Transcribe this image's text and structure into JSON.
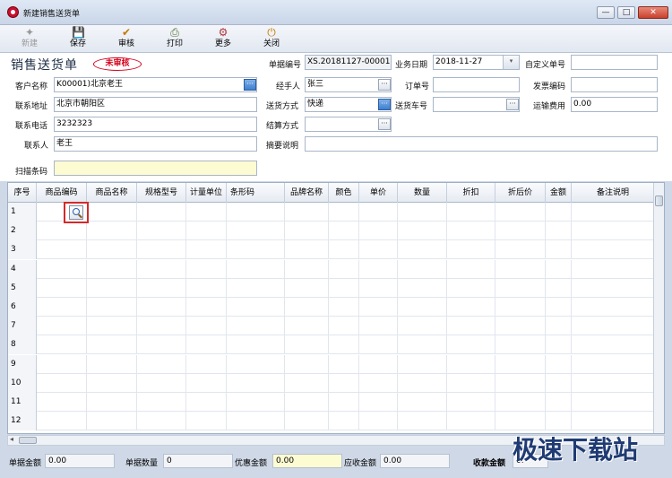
{
  "window": {
    "title": "新建销售送货单",
    "min": "—",
    "max": "□",
    "close": "✕"
  },
  "toolbar": [
    {
      "label": "新建",
      "icon": "new-icon",
      "glyph": "✦",
      "enabled": false
    },
    {
      "label": "保存",
      "icon": "save-icon",
      "glyph": "💾",
      "enabled": true
    },
    {
      "label": "审核",
      "icon": "approve-icon",
      "glyph": "✔",
      "enabled": true
    },
    {
      "label": "打印",
      "icon": "print-icon",
      "glyph": "⎙",
      "enabled": true
    },
    {
      "label": "更多",
      "icon": "more-icon",
      "glyph": "⚙",
      "enabled": true
    },
    {
      "label": "关闭",
      "icon": "close-doc-icon",
      "glyph": "⏻",
      "enabled": true
    }
  ],
  "form": {
    "doc_title": "销售送货单",
    "stamp": "未审核",
    "doc_no_label": "单据编号",
    "doc_no": "XS.20181127-00001",
    "date_label": "业务日期",
    "date": "2018-11-27",
    "custom_no_label": "自定义单号",
    "custom_no": "",
    "customer_label": "客户名称",
    "customer": "K00001)北京老王",
    "handler_label": "经手人",
    "handler": "张三",
    "order_no_label": "订单号",
    "order_no": "",
    "invoice_label": "发票编码",
    "invoice": "",
    "address_label": "联系地址",
    "address": "北京市朝阳区",
    "delivery_label": "送货方式",
    "delivery": "快递",
    "car_label": "送货车号",
    "car": "",
    "freight_label": "运输费用",
    "freight": "0.00",
    "phone_label": "联系电话",
    "phone": "3232323",
    "settle_label": "结算方式",
    "settle": "",
    "contact_label": "联系人",
    "contact": "老王",
    "memo_label": "摘要说明",
    "memo": "",
    "scan_label": "扫描条码",
    "scan": ""
  },
  "grid": {
    "columns": [
      "序号",
      "商品编码",
      "商品名称",
      "规格型号",
      "计量单位",
      "条形码",
      "品牌名称",
      "颜色",
      "单价",
      "数量",
      "折扣",
      "折后价",
      "金额",
      "备注说明"
    ],
    "rows": [
      "1",
      "2",
      "3",
      "4",
      "5",
      "6",
      "7",
      "8",
      "9",
      "10",
      "11",
      "12"
    ]
  },
  "footer": {
    "doc_amount_label": "单据金额",
    "doc_amount": "0.00",
    "doc_qty_label": "单据数量",
    "doc_qty": "0",
    "discount_label": "优惠金额",
    "discount": "0.00",
    "receivable_label": "应收金额",
    "receivable": "0.00",
    "received_label": "收款金额",
    "received": "0."
  },
  "watermark": "极速下载站"
}
